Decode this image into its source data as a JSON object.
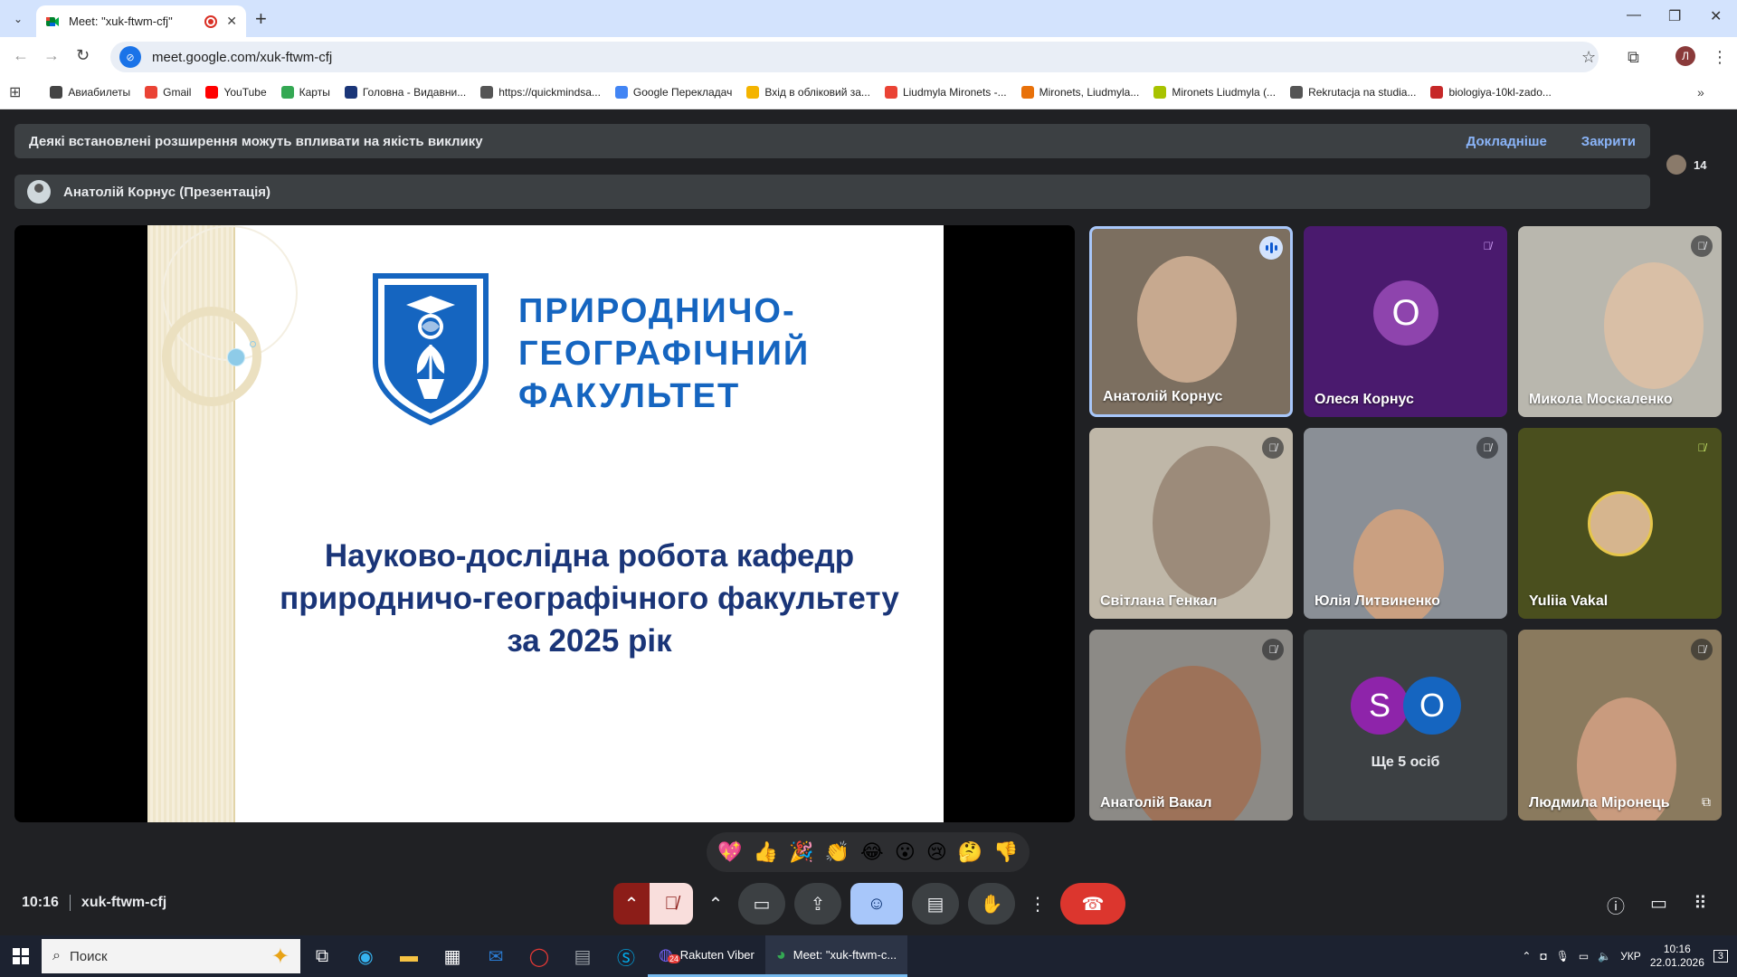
{
  "browser": {
    "tab_title": "Meet: \"xuk-ftwm-cfj\"",
    "url": "meet.google.com/xuk-ftwm-cfj",
    "profile_initial": "Л",
    "bookmarks": [
      {
        "label": "Авиабилеты",
        "color": "#444444"
      },
      {
        "label": "Gmail",
        "color": "#ea4335"
      },
      {
        "label": "YouTube",
        "color": "#ff0000"
      },
      {
        "label": "Карты",
        "color": "#34a853"
      },
      {
        "label": "Головна - Видавни...",
        "color": "#1a3578"
      },
      {
        "label": "https://quickmindsa...",
        "color": "#555555"
      },
      {
        "label": "Google Перекладач",
        "color": "#4285f4"
      },
      {
        "label": "Вхід в обліковий за...",
        "color": "#f4b400"
      },
      {
        "label": "Liudmyla Mironets -...",
        "color": "#ea4335"
      },
      {
        "label": "Mironets, Liudmyla...",
        "color": "#e8710a"
      },
      {
        "label": "Mironets Liudmyla (...",
        "color": "#a8c300"
      },
      {
        "label": "Rekrutacja na studia...",
        "color": "#555555"
      },
      {
        "label": "biologiya-10kl-zado...",
        "color": "#c62828"
      }
    ]
  },
  "meet": {
    "banner_message": "Деякі встановлені розширення можуть впливати на якість виклику",
    "banner_more": "Докладніше",
    "banner_close": "Закрити",
    "participant_count": "14",
    "presenter_label": "Анатолій Корнус (Презентація)",
    "slide": {
      "faculty_lines": [
        "ПРИРОДНИЧО-",
        "ГЕОГРАФІЧНИЙ",
        "ФАКУЛЬТЕТ"
      ],
      "topic_lines": [
        "Науково-дослідна робота кафедр",
        "природничо-географічного факультету",
        "за 2025 рік"
      ]
    },
    "participants": [
      {
        "name": "Анатолій Корнус",
        "state": "speaking"
      },
      {
        "name": "Олеся Корнус",
        "state": "muted",
        "letter": "О"
      },
      {
        "name": "Микола Москаленко",
        "state": "muted"
      },
      {
        "name": "Світлана Генкал",
        "state": "muted"
      },
      {
        "name": "Юлія Литвиненко",
        "state": "muted"
      },
      {
        "name": "Yuliia Vakal",
        "state": "muted"
      },
      {
        "name": "Анатолій Вакал",
        "state": "muted"
      },
      {
        "name": "Ще 5 осіб",
        "state": "more",
        "letters": [
          "S",
          "O"
        ]
      },
      {
        "name": "Людмила Міронець",
        "state": "muted"
      }
    ],
    "reactions": [
      "💖",
      "👍",
      "🎉",
      "👏",
      "😂",
      "😮",
      "😢",
      "🤔",
      "👎"
    ],
    "time": "10:16",
    "meeting_code": "xuk-ftwm-cfj"
  },
  "taskbar": {
    "search_placeholder": "Поиск",
    "viber_label": "Rakuten Viber",
    "viber_badge": "24",
    "chrome_label": "Meet: \"xuk-ftwm-c...",
    "lang": "УКР",
    "clock_time": "10:16",
    "clock_date": "22.01.2026",
    "notif_count": "3"
  }
}
